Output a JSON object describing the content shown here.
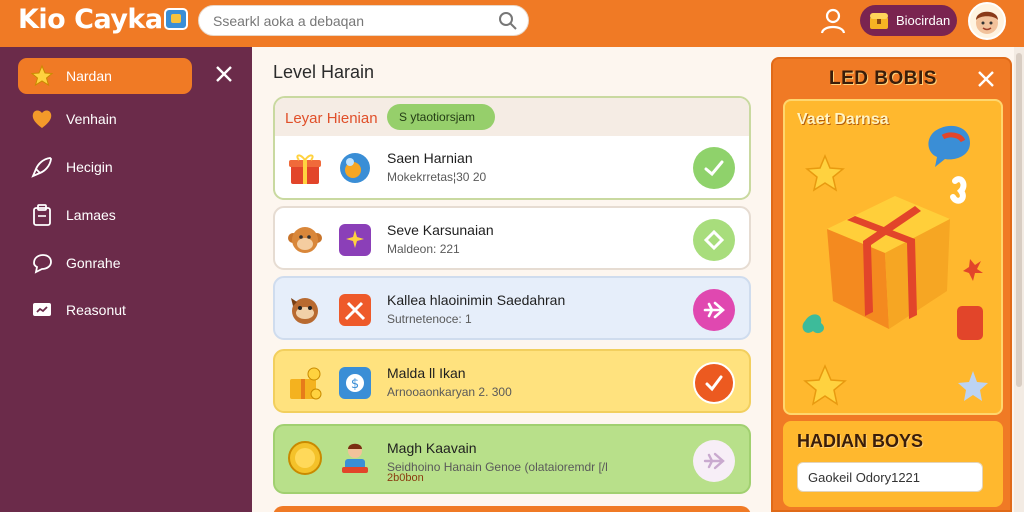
{
  "app": {
    "logo_text": "Kio Caykar",
    "search_placeholder": "Ssearkl aoka a debaqan",
    "coin_label": "Biocirdan"
  },
  "sidebar": {
    "items": [
      {
        "label": "Nardan",
        "icon": "star-icon",
        "active": true
      },
      {
        "label": "Venhain",
        "icon": "heart-icon",
        "active": false
      },
      {
        "label": "Hecigin",
        "icon": "rocket-icon",
        "active": false
      },
      {
        "label": "Lamaes",
        "icon": "clipboard-icon",
        "active": false
      },
      {
        "label": "Gonrahe",
        "icon": "chat-icon",
        "active": false
      },
      {
        "label": "Reasonut",
        "icon": "message-icon",
        "active": false
      }
    ]
  },
  "main": {
    "title": "Level Harain",
    "list_header": "Leyar Hienian",
    "list_pill": "S ytaotiorsjam",
    "rows": [
      {
        "title": "Saen Harnian",
        "sub": "Mokekrretas¦30 20",
        "sub2": "",
        "bg": "#ffffff",
        "border": "#c9d9a0",
        "btn_color": "#8fd26b",
        "btn_icon": "check-icon"
      },
      {
        "title": "Seve Karsunaian",
        "sub": "Maldeon: 221",
        "sub2": "",
        "bg": "#ffffff",
        "border": "#e6dcd2",
        "btn_color": "#a8dd7c",
        "btn_icon": "tag-icon"
      },
      {
        "title": "Kallea hlaoinimin Saedahran",
        "sub": "Sutrnetenoce: 1",
        "sub2": "",
        "bg": "#e6eefa",
        "border": "#cfdcee",
        "btn_color": "#e048b0",
        "btn_icon": "plane-icon"
      },
      {
        "title": "Malda ll Ikan",
        "sub": "Arnooaonkaryan 2. 300",
        "sub2": "",
        "bg": "#ffe27e",
        "border": "#f2cf5e",
        "btn_color": "#ec5a20",
        "btn_icon": "check-icon"
      },
      {
        "title": "Magh Kaavain",
        "sub": "Seidhoino Hanain Genoe (olataioremdr [/l",
        "sub2": "2b0bon",
        "bg": "#b8e08a",
        "border": "#a1d070",
        "btn_color": "#f7eef7",
        "btn_icon": "plane-icon"
      }
    ]
  },
  "panel": {
    "title": "LED BOBIS",
    "card_title": "Vaet Darnsa",
    "section_title": "HADIAN BOYS",
    "field_value": "Gaokeil Odory1221"
  },
  "colors": {
    "topbar": "#f07a25",
    "sidebar": "#6b2b4a",
    "accent": "#f07a25"
  }
}
